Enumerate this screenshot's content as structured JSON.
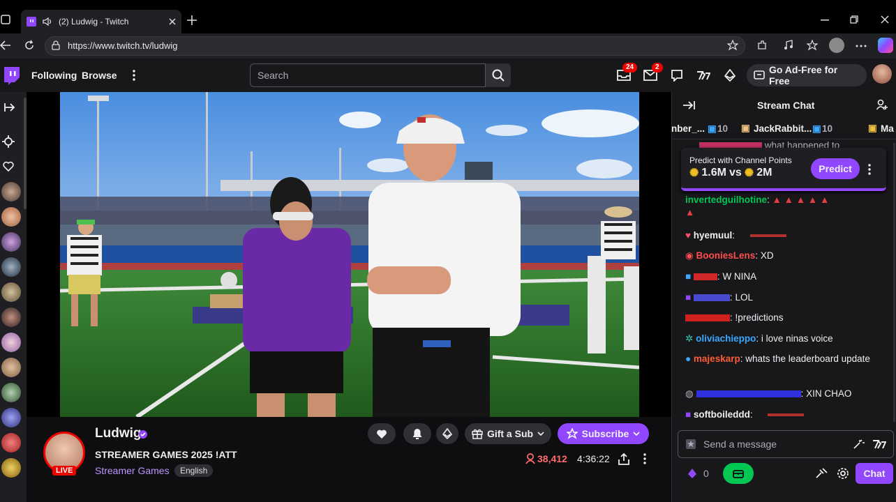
{
  "browser": {
    "tab_title": "(2) Ludwig - Twitch",
    "url": "https://www.twitch.tv/ludwig"
  },
  "nav": {
    "following": "Following",
    "browse": "Browse",
    "search_placeholder": "Search",
    "inbox_count": "24",
    "whispers_count": "2",
    "adfree_label": "Go Ad-Free for Free"
  },
  "channel": {
    "name": "Ludwig",
    "title": "STREAMER GAMES 2025 !ATT",
    "category": "Streamer Games",
    "language_tag": "English",
    "live_badge": "LIVE",
    "viewers": "38,412",
    "uptime": "4:36:22",
    "gift_label": "Gift a Sub",
    "subscribe_label": "Subscribe"
  },
  "chat": {
    "header": "Stream Chat",
    "gift_leaders": [
      {
        "name": "nber_...",
        "count": "10"
      },
      {
        "name": "JackRabbit...",
        "count": "10"
      },
      {
        "name": "Ma",
        "count": ""
      }
    ],
    "partial_message": "what happened to",
    "prediction": {
      "title": "Predict with Channel Points",
      "left": "1.6M",
      "vs": "vs",
      "right": "2M",
      "button": "Predict"
    },
    "messages": [
      {
        "user": "invertedguilhotine",
        "color": "#00c853",
        "text": ""
      },
      {
        "user": "hyemuul",
        "color": "#efeff1",
        "text": ""
      },
      {
        "user": "BooniesLens",
        "color": "#ff4d4d",
        "text": "XD"
      },
      {
        "user": "",
        "color": "#ff3c3c",
        "text": "W NINA"
      },
      {
        "user": "",
        "color": "#6a5acd",
        "text": "LOL"
      },
      {
        "user": "",
        "color": "#e02020",
        "text": "!predictions"
      },
      {
        "user": "oliviachieppo",
        "color": "#3ba7ff",
        "text": "i love ninas voice"
      },
      {
        "user": "majeskarp",
        "color": "#ff5a36",
        "text": "whats the leaderboard update"
      },
      {
        "user": "",
        "color": "#3a3aff",
        "text": "XIN CHAO"
      },
      {
        "user": "softboileddd",
        "color": "#efeff1",
        "text": ""
      }
    ],
    "input_placeholder": "Send a message",
    "points": "0",
    "chat_button": "Chat"
  },
  "colors": {
    "brand": "#9147ff",
    "live": "#eb0400",
    "viewer": "#ff6b6b"
  }
}
